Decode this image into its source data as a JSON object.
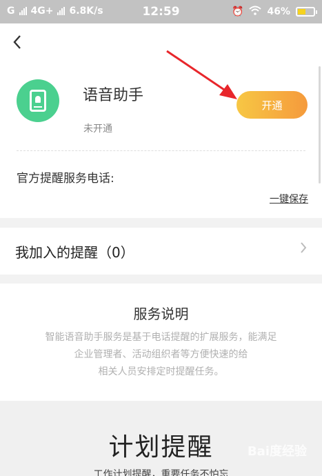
{
  "status_bar": {
    "carrier1": "G",
    "carrier2": "4G+",
    "speed": "6.8K/s",
    "time": "12:59",
    "battery": "46%"
  },
  "header": {
    "back_icon": "chevron-left-icon"
  },
  "assistant": {
    "name": "语音助手",
    "status": "未开通",
    "action_label": "开通",
    "icon": "phone-bell-icon",
    "icon_color": "#4bd08f"
  },
  "hotline": {
    "label": "官方提醒服务电话:",
    "save_label": "一键保存"
  },
  "my_reminders": {
    "label": "我加入的提醒（0）"
  },
  "service": {
    "title": "服务说明",
    "lines": [
      "智能语音助手服务是基于电话提醒的扩展服务，能满足",
      "企业管理者、活动组织者等方便快速的给",
      "相关人员安排定时提醒任务。"
    ]
  },
  "plan": {
    "title": "计划提醒",
    "subtitle": "工作计划提醒，重要任务不怕忘"
  },
  "watermark": "Bai度经验",
  "colors": {
    "accent_start": "#f7c744",
    "accent_end": "#f59a3c",
    "annotation_arrow": "#e8262b"
  }
}
